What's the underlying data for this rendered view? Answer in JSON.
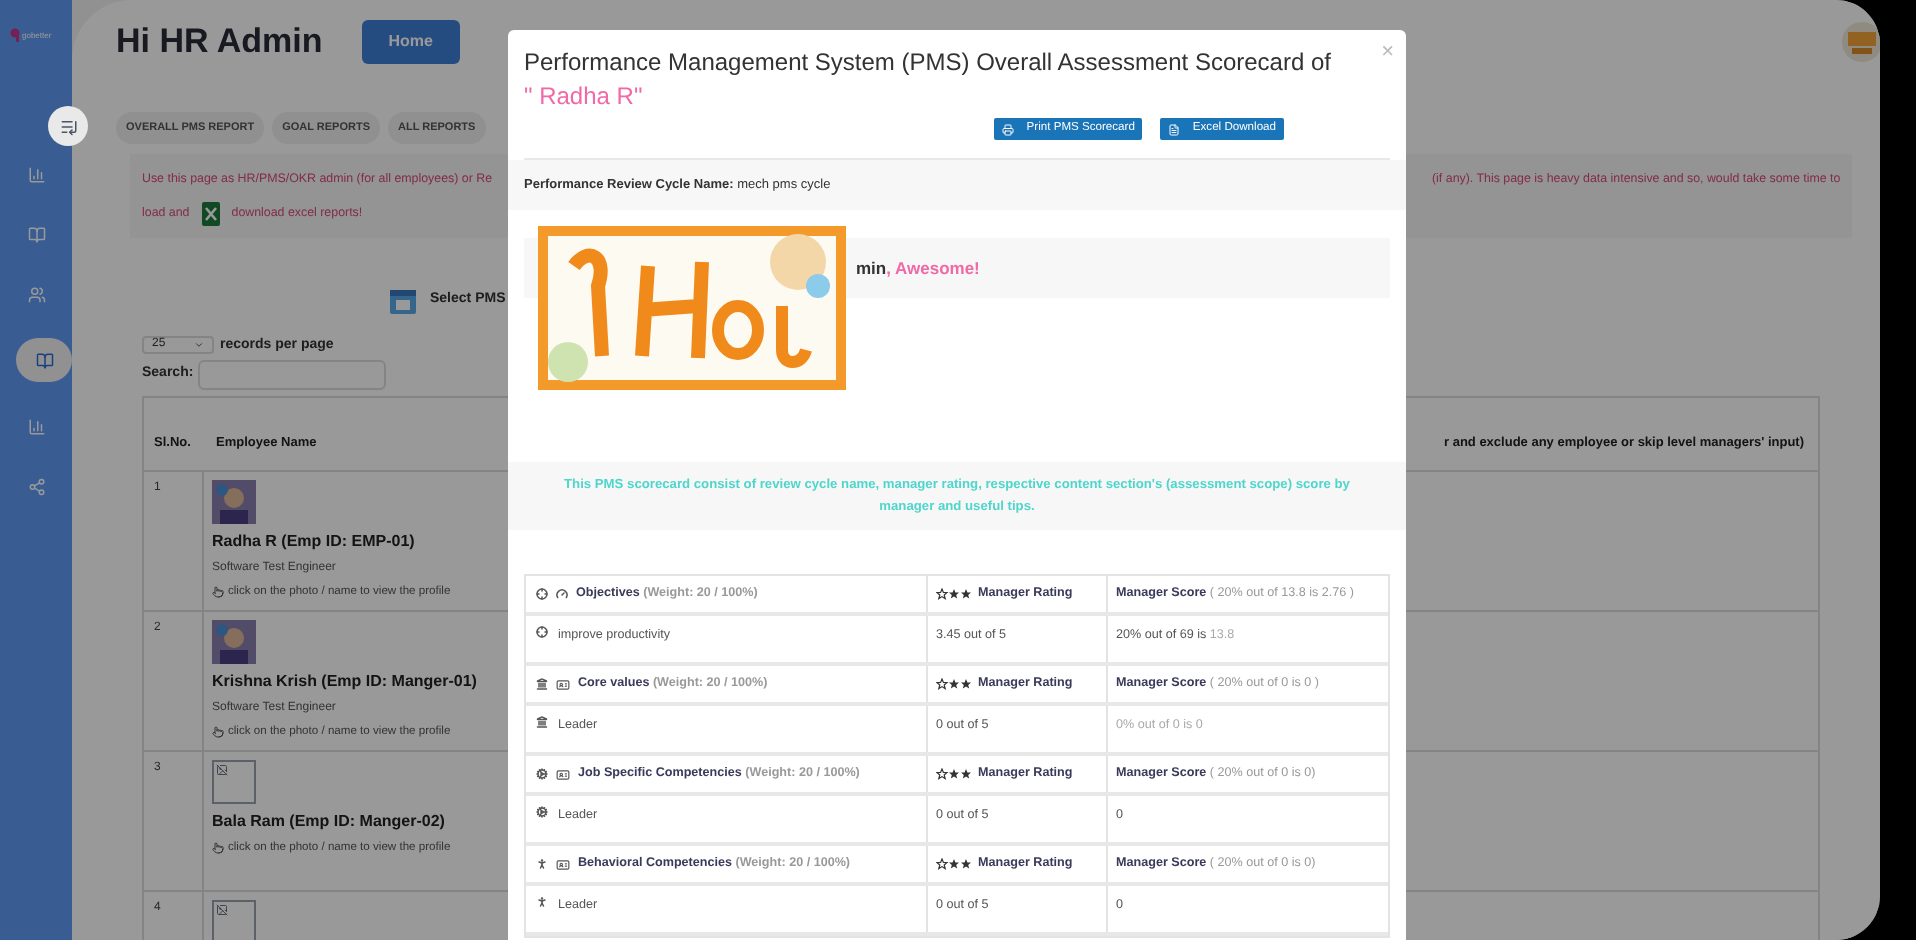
{
  "sidebar": {
    "logo": "gobetter",
    "items": [
      {
        "kind": "chart",
        "selected": false
      },
      {
        "kind": "book",
        "selected": false
      },
      {
        "kind": "users",
        "selected": false
      },
      {
        "kind": "book",
        "selected": true
      },
      {
        "kind": "chart",
        "selected": false
      },
      {
        "kind": "share",
        "selected": false
      }
    ]
  },
  "header": {
    "greeting": "Hi HR Admin",
    "home_button": "Home"
  },
  "tabs": [
    {
      "label": "OVERALL PMS REPORT",
      "selected": false
    },
    {
      "label": "GOAL REPORTS",
      "selected": false
    },
    {
      "label": "ALL REPORTS",
      "selected": false
    }
  ],
  "notice": {
    "line_1_left": "Use this page as HR/PMS/OKR admin (for all employees) or Re",
    "line_1_right": "(if any). This page is heavy data intensive and so, would take some time to",
    "line_2_left": "load and",
    "line_2_right": "download excel reports!"
  },
  "select_label": "Select PMS",
  "page_size": {
    "value": "25",
    "label": "records per page"
  },
  "search_label": "Search:",
  "table": {
    "columns": [
      "Sl.No.",
      "Employee Name"
    ],
    "column_right": "r and exclude any employee or skip level managers' input)",
    "rows": [
      {
        "number": "1",
        "kind": "picture",
        "name": "Radha R (Emp ID: EMP-01)",
        "title": "Software Test Engineer",
        "hint": "click on the photo / name to view the profile"
      },
      {
        "number": "2",
        "kind": "picture",
        "name": "Krishna Krish (Emp ID: Manger-01)",
        "title": "Software Test Engineer",
        "hint": "click on the photo / name to view the profile"
      },
      {
        "number": "3",
        "kind": "broken",
        "name": "Bala Ram (Emp ID: Manger-02)",
        "hint": "click on the photo / name to view the profile"
      },
      {
        "number": "4",
        "kind": "broken"
      }
    ]
  },
  "modal": {
    "title": "Performance Management System (PMS) Overall Assessment Scorecard of",
    "employee": "\" Radha R\"",
    "close": "×",
    "buttons": [
      {
        "label": "Print PMS Scorecard",
        "kind": "print"
      },
      {
        "label": "Excel Download",
        "kind": "file"
      }
    ],
    "cycle_label": "Performance Review Cycle Name:",
    "cycle_value": "mech pms cycle",
    "greeting_tail": "min",
    "greeting_praise": ", Awesome!",
    "info": "This PMS scorecard consist of review cycle name, manager rating, respective content section's (assessment scope) score by manager and useful tips.",
    "sections": [
      {
        "kind": "objectives",
        "title": "Objectives",
        "weight": "(Weight:  20 / 100%)",
        "rating_label": "Manager Rating",
        "score_label": "Manager Score",
        "score_detail": "( 20% out of 13.8 is 2.76 )",
        "items": [
          {
            "name": "improve productivity",
            "rating": "3.45 out of 5",
            "score": [
              {
                "text": "20% out of 69 is",
                "muted": false
              },
              {
                "text": "13.8",
                "muted": true
              }
            ]
          }
        ]
      },
      {
        "kind": "values",
        "title": "Core values",
        "weight": "(Weight:  20 / 100%)",
        "rating_label": "Manager Rating",
        "score_label": "Manager Score",
        "score_detail": "( 20% out of 0 is 0 )",
        "items": [
          {
            "name": "Leader",
            "rating": "0 out of 5",
            "score": [
              {
                "text": "0% out of 0 is 0",
                "muted": true
              }
            ]
          }
        ]
      },
      {
        "kind": "skills",
        "title": "Job Specific Competencies",
        "weight": "(Weight:  20 / 100%)",
        "rating_label": "Manager Rating",
        "score_label": "Manager Score",
        "score_detail": "( 20% out of 0 is 0)",
        "items": [
          {
            "name": "Leader",
            "rating": "0 out of 5",
            "score": [
              {
                "text": "0",
                "muted": false
              }
            ]
          }
        ]
      },
      {
        "kind": "behavior",
        "title": "Behavioral Competencies",
        "weight": "(Weight:  20 / 100%)",
        "rating_label": "Manager Rating",
        "score_label": "Manager Score",
        "score_detail": "( 20% out of 0 is 0)",
        "items": [
          {
            "name": "Leader",
            "rating": "0 out of 5",
            "score": [
              {
                "text": "0",
                "muted": false
              }
            ]
          }
        ]
      }
    ]
  }
}
